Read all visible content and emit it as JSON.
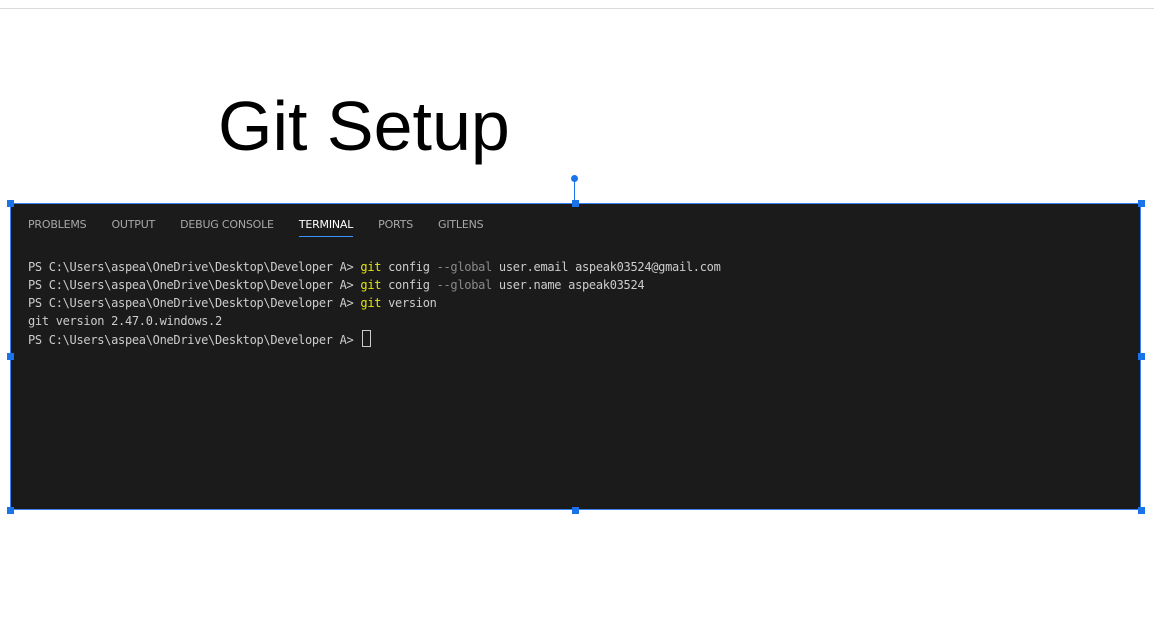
{
  "slide": {
    "title": "Git Setup"
  },
  "terminal": {
    "tabs": [
      {
        "label": "PROBLEMS",
        "active": false
      },
      {
        "label": "OUTPUT",
        "active": false
      },
      {
        "label": "DEBUG CONSOLE",
        "active": false
      },
      {
        "label": "TERMINAL",
        "active": true
      },
      {
        "label": "PORTS",
        "active": false
      },
      {
        "label": "GITLENS",
        "active": false
      }
    ],
    "lines": [
      {
        "prompt": "PS C:\\Users\\aspea\\OneDrive\\Desktop\\Developer A> ",
        "cmd": "git",
        "text1": " config ",
        "flag": "--global",
        "text2": " user.email aspeak03524@gmail.com"
      },
      {
        "prompt": "PS C:\\Users\\aspea\\OneDrive\\Desktop\\Developer A> ",
        "cmd": "git",
        "text1": " config ",
        "flag": "--global",
        "text2": " user.name aspeak03524"
      },
      {
        "prompt": "PS C:\\Users\\aspea\\OneDrive\\Desktop\\Developer A> ",
        "cmd": "git",
        "text1": " version",
        "flag": "",
        "text2": ""
      },
      {
        "output": "git version 2.47.0.windows.2"
      },
      {
        "prompt": "PS C:\\Users\\aspea\\OneDrive\\Desktop\\Developer A> ",
        "cursor": true
      }
    ]
  },
  "colors": {
    "terminal_bg": "#1b1b1c",
    "command_yellow": "#e5e510",
    "flag_gray": "#8a8a8a",
    "selection_blue": "#1a73e8",
    "active_tab_underline": "#3794ff"
  }
}
